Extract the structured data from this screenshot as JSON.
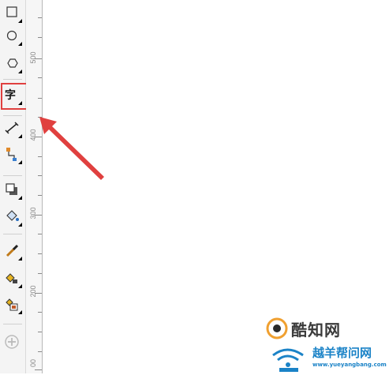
{
  "toolbox": {
    "tools": [
      {
        "name": "rectangle-tool",
        "icon": "rectangle-icon"
      },
      {
        "name": "ellipse-tool",
        "icon": "ellipse-icon"
      },
      {
        "name": "polygon-tool",
        "icon": "hexagon-icon"
      },
      {
        "name": "text-tool",
        "icon": "text-icon",
        "glyph": "字"
      },
      {
        "name": "dimension-tool",
        "icon": "dimension-icon"
      },
      {
        "name": "connector-tool",
        "icon": "connector-icon"
      },
      {
        "name": "drop-shadow-tool",
        "icon": "drop-shadow-icon"
      },
      {
        "name": "fill-tool",
        "icon": "bucket-icon"
      },
      {
        "name": "eyedropper-tool",
        "icon": "eyedropper-icon"
      },
      {
        "name": "interactive-fill-tool",
        "icon": "interactive-fill-icon"
      },
      {
        "name": "smart-fill-tool",
        "icon": "smart-fill-icon"
      },
      {
        "name": "add-tool",
        "icon": "plus-circle-icon"
      }
    ]
  },
  "ruler": {
    "labels": [
      "500",
      "400",
      "300",
      "200",
      "00"
    ]
  },
  "watermark": {
    "site1": "酷知网",
    "site2": "越羊帮问网",
    "site2_url": "www.yueyangbang.com"
  },
  "colors": {
    "highlight": "#e0403f",
    "watermark_blue": "#1b83c7"
  }
}
